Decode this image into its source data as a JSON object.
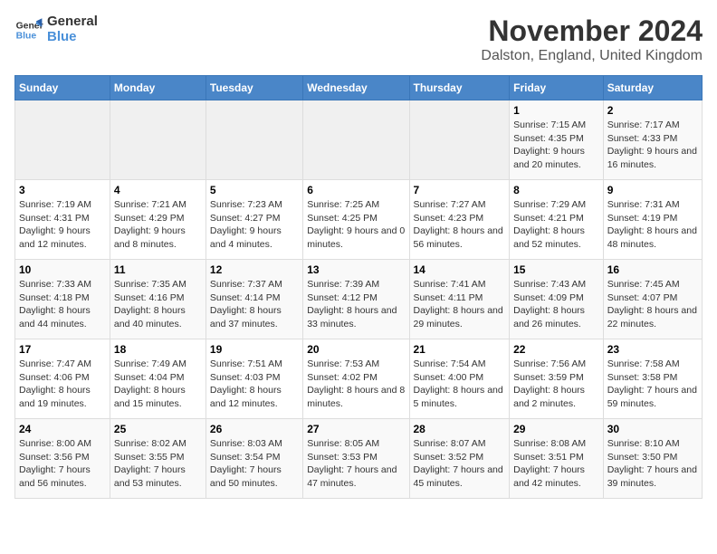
{
  "logo": {
    "line1": "General",
    "line2": "Blue"
  },
  "title": "November 2024",
  "subtitle": "Dalston, England, United Kingdom",
  "days_of_week": [
    "Sunday",
    "Monday",
    "Tuesday",
    "Wednesday",
    "Thursday",
    "Friday",
    "Saturday"
  ],
  "weeks": [
    [
      {
        "day": "",
        "info": ""
      },
      {
        "day": "",
        "info": ""
      },
      {
        "day": "",
        "info": ""
      },
      {
        "day": "",
        "info": ""
      },
      {
        "day": "",
        "info": ""
      },
      {
        "day": "1",
        "info": "Sunrise: 7:15 AM\nSunset: 4:35 PM\nDaylight: 9 hours and 20 minutes."
      },
      {
        "day": "2",
        "info": "Sunrise: 7:17 AM\nSunset: 4:33 PM\nDaylight: 9 hours and 16 minutes."
      }
    ],
    [
      {
        "day": "3",
        "info": "Sunrise: 7:19 AM\nSunset: 4:31 PM\nDaylight: 9 hours and 12 minutes."
      },
      {
        "day": "4",
        "info": "Sunrise: 7:21 AM\nSunset: 4:29 PM\nDaylight: 9 hours and 8 minutes."
      },
      {
        "day": "5",
        "info": "Sunrise: 7:23 AM\nSunset: 4:27 PM\nDaylight: 9 hours and 4 minutes."
      },
      {
        "day": "6",
        "info": "Sunrise: 7:25 AM\nSunset: 4:25 PM\nDaylight: 9 hours and 0 minutes."
      },
      {
        "day": "7",
        "info": "Sunrise: 7:27 AM\nSunset: 4:23 PM\nDaylight: 8 hours and 56 minutes."
      },
      {
        "day": "8",
        "info": "Sunrise: 7:29 AM\nSunset: 4:21 PM\nDaylight: 8 hours and 52 minutes."
      },
      {
        "day": "9",
        "info": "Sunrise: 7:31 AM\nSunset: 4:19 PM\nDaylight: 8 hours and 48 minutes."
      }
    ],
    [
      {
        "day": "10",
        "info": "Sunrise: 7:33 AM\nSunset: 4:18 PM\nDaylight: 8 hours and 44 minutes."
      },
      {
        "day": "11",
        "info": "Sunrise: 7:35 AM\nSunset: 4:16 PM\nDaylight: 8 hours and 40 minutes."
      },
      {
        "day": "12",
        "info": "Sunrise: 7:37 AM\nSunset: 4:14 PM\nDaylight: 8 hours and 37 minutes."
      },
      {
        "day": "13",
        "info": "Sunrise: 7:39 AM\nSunset: 4:12 PM\nDaylight: 8 hours and 33 minutes."
      },
      {
        "day": "14",
        "info": "Sunrise: 7:41 AM\nSunset: 4:11 PM\nDaylight: 8 hours and 29 minutes."
      },
      {
        "day": "15",
        "info": "Sunrise: 7:43 AM\nSunset: 4:09 PM\nDaylight: 8 hours and 26 minutes."
      },
      {
        "day": "16",
        "info": "Sunrise: 7:45 AM\nSunset: 4:07 PM\nDaylight: 8 hours and 22 minutes."
      }
    ],
    [
      {
        "day": "17",
        "info": "Sunrise: 7:47 AM\nSunset: 4:06 PM\nDaylight: 8 hours and 19 minutes."
      },
      {
        "day": "18",
        "info": "Sunrise: 7:49 AM\nSunset: 4:04 PM\nDaylight: 8 hours and 15 minutes."
      },
      {
        "day": "19",
        "info": "Sunrise: 7:51 AM\nSunset: 4:03 PM\nDaylight: 8 hours and 12 minutes."
      },
      {
        "day": "20",
        "info": "Sunrise: 7:53 AM\nSunset: 4:02 PM\nDaylight: 8 hours and 8 minutes."
      },
      {
        "day": "21",
        "info": "Sunrise: 7:54 AM\nSunset: 4:00 PM\nDaylight: 8 hours and 5 minutes."
      },
      {
        "day": "22",
        "info": "Sunrise: 7:56 AM\nSunset: 3:59 PM\nDaylight: 8 hours and 2 minutes."
      },
      {
        "day": "23",
        "info": "Sunrise: 7:58 AM\nSunset: 3:58 PM\nDaylight: 7 hours and 59 minutes."
      }
    ],
    [
      {
        "day": "24",
        "info": "Sunrise: 8:00 AM\nSunset: 3:56 PM\nDaylight: 7 hours and 56 minutes."
      },
      {
        "day": "25",
        "info": "Sunrise: 8:02 AM\nSunset: 3:55 PM\nDaylight: 7 hours and 53 minutes."
      },
      {
        "day": "26",
        "info": "Sunrise: 8:03 AM\nSunset: 3:54 PM\nDaylight: 7 hours and 50 minutes."
      },
      {
        "day": "27",
        "info": "Sunrise: 8:05 AM\nSunset: 3:53 PM\nDaylight: 7 hours and 47 minutes."
      },
      {
        "day": "28",
        "info": "Sunrise: 8:07 AM\nSunset: 3:52 PM\nDaylight: 7 hours and 45 minutes."
      },
      {
        "day": "29",
        "info": "Sunrise: 8:08 AM\nSunset: 3:51 PM\nDaylight: 7 hours and 42 minutes."
      },
      {
        "day": "30",
        "info": "Sunrise: 8:10 AM\nSunset: 3:50 PM\nDaylight: 7 hours and 39 minutes."
      }
    ]
  ]
}
